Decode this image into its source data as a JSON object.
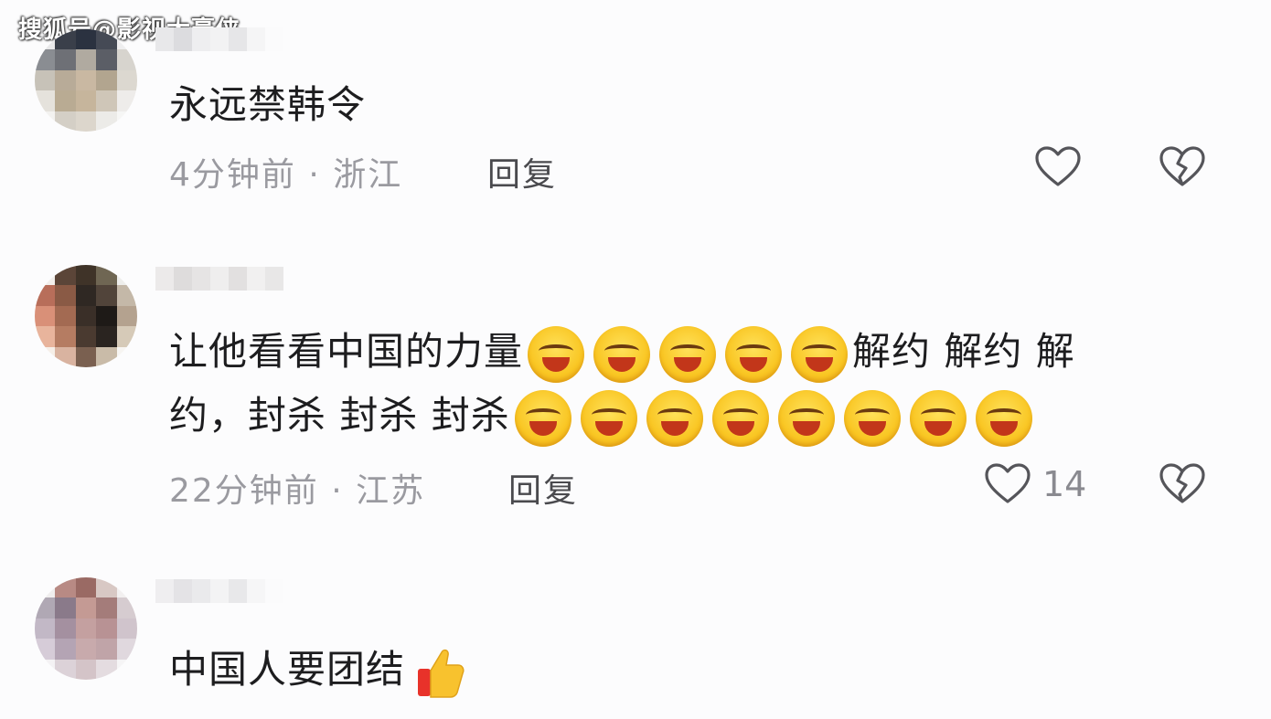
{
  "watermark": "搜狐号@影视大豪侠",
  "comments": [
    {
      "text": "永远禁韩令",
      "time": "4分钟前",
      "separator": "·",
      "location": "浙江",
      "reply_label": "回复",
      "like_count": ""
    },
    {
      "text_line1_start": "让他看看中国的力量",
      "text_line1_end": "解约 解约 解",
      "text_line2_start": "约，封杀 封杀 封杀",
      "time": "22分钟前",
      "separator": "·",
      "location": "江苏",
      "reply_label": "回复",
      "like_count": "14"
    },
    {
      "text": "中国人要团结"
    }
  ],
  "icons": {
    "like": "heart-outline-icon",
    "dislike": "broken-heart-icon",
    "emoji": "smirk-laugh-emoji",
    "thumb": "thumbs-up-emoji"
  },
  "colors": {
    "text": "#1d1d1f",
    "meta": "#9a9aa0",
    "reply": "#4a4a4e",
    "icon_stroke": "#55555a"
  }
}
